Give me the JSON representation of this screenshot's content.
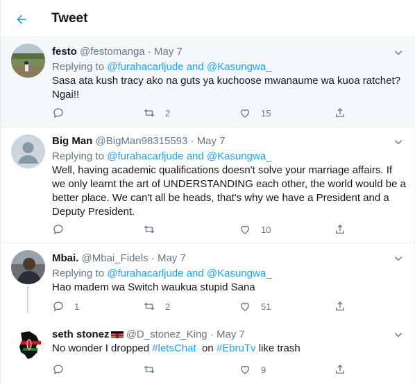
{
  "header": {
    "title": "Tweet",
    "back_icon": "arrow-left-icon"
  },
  "colors": {
    "accent": "#1da1f2",
    "muted": "#657786",
    "text": "#14171a",
    "highlight_bg": "#f5f8fa"
  },
  "tweets": [
    {
      "name": "festo",
      "handle": "@festomanga",
      "sep": "·",
      "date": "May 7",
      "replying_prefix": "Replying to",
      "replying_to_1": "@furahacarljude",
      "replying_and": "and",
      "replying_to_2": "@Kasungwa_",
      "text": "Sasa ata kush tracy ako na guts ya kuchoose mwanaume wa kuoa ratchet? Ngai!!",
      "replies": "",
      "retweets": "2",
      "likes": "15"
    },
    {
      "name": "Big Man",
      "handle": "@BigMan98315593",
      "sep": "·",
      "date": "May 7",
      "replying_prefix": "Replying to",
      "replying_to_1": "@furahacarljude",
      "replying_and": "and",
      "replying_to_2": "@Kasungwa_",
      "text": "Well, having academic qualifications doesn't solve your marriage affairs. If we only learnt the art of UNDERSTANDING each other, the world would be a better place. We can't all be heads, that's why we have a President and a Deputy President.",
      "replies": "",
      "retweets": "",
      "likes": "10"
    },
    {
      "name": "Mbai.",
      "handle": "@Mbai_Fidels",
      "sep": "·",
      "date": "May 7",
      "replying_prefix": "Replying to",
      "replying_to_1": "@furahacarljude",
      "replying_and": "and",
      "replying_to_2": "@Kasungwa_",
      "text": "Hao madem wa Switch waukua stupid Sana",
      "replies": "1",
      "retweets": "2",
      "likes": "51"
    },
    {
      "name": "seth stonez",
      "handle": "@D_stonez_King",
      "sep": "·",
      "date": "May 7",
      "text_before": "No wonder I dropped ",
      "hashtag_1": "#letsChat",
      "text_middle": "  on ",
      "hashtag_2": "#EbruTv",
      "text_after": " like trash",
      "replies": "",
      "retweets": "",
      "likes": "9"
    }
  ]
}
